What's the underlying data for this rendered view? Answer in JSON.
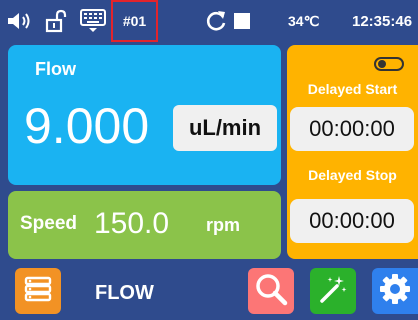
{
  "status_bar": {
    "icons": [
      "speaker-icon",
      "unlock-icon",
      "keyboard-icon"
    ],
    "device_id": "#01",
    "controls": [
      "refresh-icon",
      "stop-icon"
    ],
    "temperature": "34℃",
    "time": "12:35:46"
  },
  "flow_panel": {
    "label": "Flow",
    "value": "9.000",
    "unit": "uL/min",
    "color": "#1ab3f2"
  },
  "speed_panel": {
    "label": "Speed",
    "value": "150.0",
    "unit": "rpm",
    "color": "#8bc34a"
  },
  "delay_panel": {
    "toggle_on": false,
    "start_label": "Delayed Start",
    "start_time": "00:00:00",
    "stop_label": "Delayed Stop",
    "stop_time": "00:00:00",
    "color": "#ffb300"
  },
  "bottom_bar": {
    "mode_label": "FLOW",
    "buttons": [
      "menu-icon",
      "search-icon",
      "magic-wand-icon",
      "gear-icon"
    ]
  },
  "colors": {
    "background": "#2f4b8d",
    "highlight_box": "#e3242b"
  }
}
